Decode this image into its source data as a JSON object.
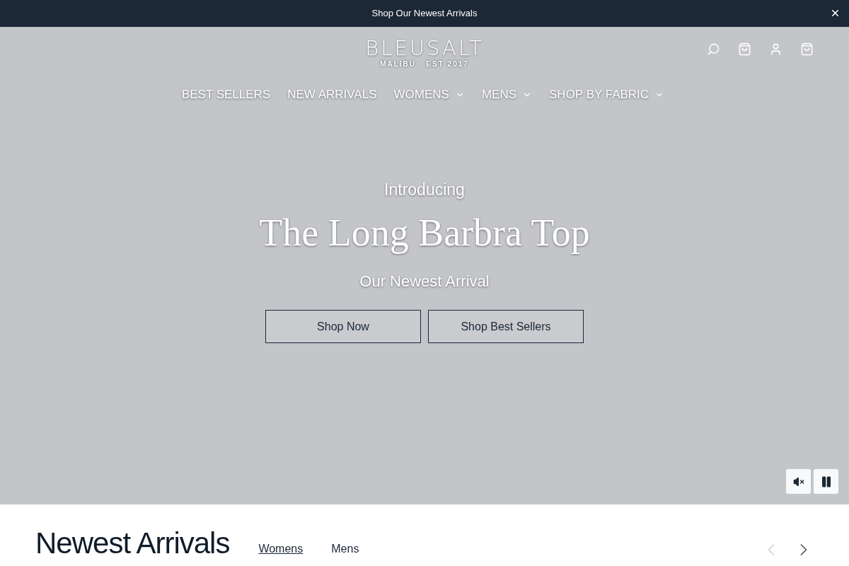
{
  "announcement": {
    "text": "Shop Our Newest Arrivals"
  },
  "logo": {
    "name": "BLEUSALT",
    "tagline": "MALIBU   EST 2017"
  },
  "nav": [
    {
      "label": "BEST SELLERS",
      "has_menu": false
    },
    {
      "label": "NEW ARRIVALS",
      "has_menu": false
    },
    {
      "label": "WOMENS",
      "has_menu": true
    },
    {
      "label": "MENS",
      "has_menu": true
    },
    {
      "label": "SHOP BY FABRIC",
      "has_menu": true
    }
  ],
  "hero": {
    "eyebrow": "Introducing",
    "title": "The Long Barbra Top",
    "subtitle": "Our Newest Arrival",
    "buttons": [
      "Shop Now",
      "Shop Best Sellers"
    ],
    "muted": true,
    "playing": true
  },
  "section": {
    "title": "Newest Arrivals",
    "tabs": [
      {
        "label": "Womens",
        "selected": true
      },
      {
        "label": "Mens",
        "selected": false
      }
    ],
    "prev_disabled": true,
    "next_disabled": false
  }
}
